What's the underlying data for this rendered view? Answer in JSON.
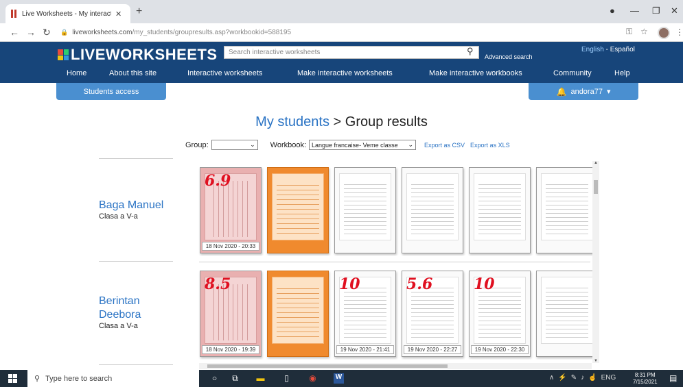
{
  "browser": {
    "tab_title": "Live Worksheets - My interactive",
    "url_host": "liveworksheets.com",
    "url_path": "/my_students/groupresults.asp?workbookid=588195"
  },
  "site": {
    "logo": "LIVEWORKSHEETS",
    "search_placeholder": "Search interactive worksheets",
    "advanced_search": "Advanced search",
    "lang_en": "English",
    "lang_sep": "-",
    "lang_es": "Español",
    "nav": [
      "Home",
      "About this site",
      "Interactive worksheets",
      "Make interactive worksheets",
      "Make interactive workbooks",
      "Community",
      "Help"
    ],
    "students_access": "Students access",
    "username": "andora77"
  },
  "main": {
    "title_link": "My students",
    "title_rest": " > Group results",
    "group_label": "Group:",
    "workbook_label": "Workbook:",
    "workbook_value": "Langue francaise- Veme classe",
    "export_csv": "Export as CSV",
    "export_xls": "Export as XLS"
  },
  "students": [
    {
      "name_line1": "Baga Manuel",
      "name_line2": "",
      "class": "Clasa a V-a",
      "worksheets": [
        {
          "score": "6.9",
          "date": "18 Nov 2020 - 20:33",
          "style": "pink"
        },
        {
          "score": "",
          "date": "",
          "style": "orange"
        },
        {
          "score": "",
          "date": "",
          "style": "plain"
        },
        {
          "score": "",
          "date": "",
          "style": "plain"
        },
        {
          "score": "",
          "date": "",
          "style": "plain"
        },
        {
          "score": "",
          "date": "",
          "style": "plain"
        }
      ]
    },
    {
      "name_line1": "Berintan",
      "name_line2": "Deebora",
      "class": "Clasa a V-a",
      "worksheets": [
        {
          "score": "8.5",
          "date": "18 Nov 2020 - 19:39",
          "style": "pink"
        },
        {
          "score": "",
          "date": "",
          "style": "orange"
        },
        {
          "score": "10",
          "date": "19 Nov 2020 - 21:41",
          "style": "plain"
        },
        {
          "score": "5.6",
          "date": "19 Nov 2020 - 22:27",
          "style": "plain"
        },
        {
          "score": "10",
          "date": "19 Nov 2020 - 22:30",
          "style": "plain"
        },
        {
          "score": "",
          "date": "",
          "style": "plain"
        }
      ]
    }
  ],
  "taskbar": {
    "search_placeholder": "Type here to search",
    "lang": "ENG",
    "time": "8:31 PM",
    "date": "7/15/2021"
  }
}
